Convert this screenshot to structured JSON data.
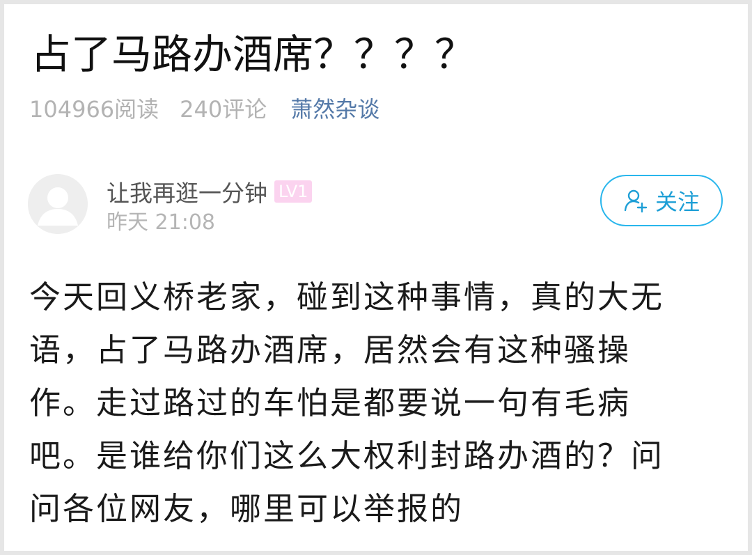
{
  "article": {
    "title": "占了马路办酒席？？？？",
    "read_count": "104966阅读",
    "comment_count": "240评论",
    "source": "萧然杂谈"
  },
  "author": {
    "name": "让我再逛一分钟",
    "level": "LV1",
    "time": "昨天 21:08",
    "follow_label": "关注"
  },
  "body": {
    "lines": [
      "今天回义桥老家，碰到这种事情，真的大无",
      "语，占了马路办酒席，居然会有这种骚操",
      "作。走过路过的车怕是都要说一句有毛病",
      "吧。是谁给你们这么大权利封路办酒的？问",
      "问各位网友，哪里可以举报的"
    ]
  },
  "colors": {
    "accent": "#29b6ec",
    "source_link": "#5479a8",
    "level_badge": "#fbd3ef",
    "muted": "#b3b3b3"
  },
  "icons": {
    "avatar": "default-avatar-icon",
    "follow": "add-user-icon"
  }
}
